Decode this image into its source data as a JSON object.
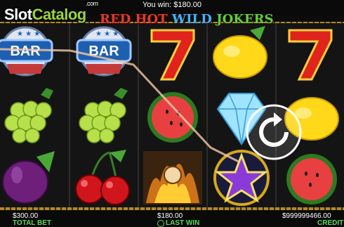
{
  "watermark": {
    "part1": "Slot",
    "part2": "Catalog",
    "suffix": ".com"
  },
  "header": {
    "you_win_label": "You win: $180.00"
  },
  "title": {
    "part1": "RED HOT ",
    "part2": "WILD ",
    "part3": "JOKERS"
  },
  "reels": [
    [
      "bar",
      "grapes",
      "plum"
    ],
    [
      "bar",
      "grapes",
      "cherries"
    ],
    [
      "seven",
      "watermelon",
      "joker-wild"
    ],
    [
      "lemon",
      "diamond",
      "star"
    ],
    [
      "seven",
      "lemon",
      "watermelon"
    ]
  ],
  "bar_symbol_text": "BAR",
  "footer": {
    "total_bet_value": "$300.00",
    "total_bet_label": "TOTAL BET",
    "last_win_value": "$180.00",
    "last_win_label": "LAST WIN",
    "credit_value": "$999999466.00",
    "credit_label": "CREDIT"
  },
  "colors": {
    "accent_green": "#58d85a",
    "reel_bg": "#141414",
    "frame_gold": "#b08a2a"
  }
}
